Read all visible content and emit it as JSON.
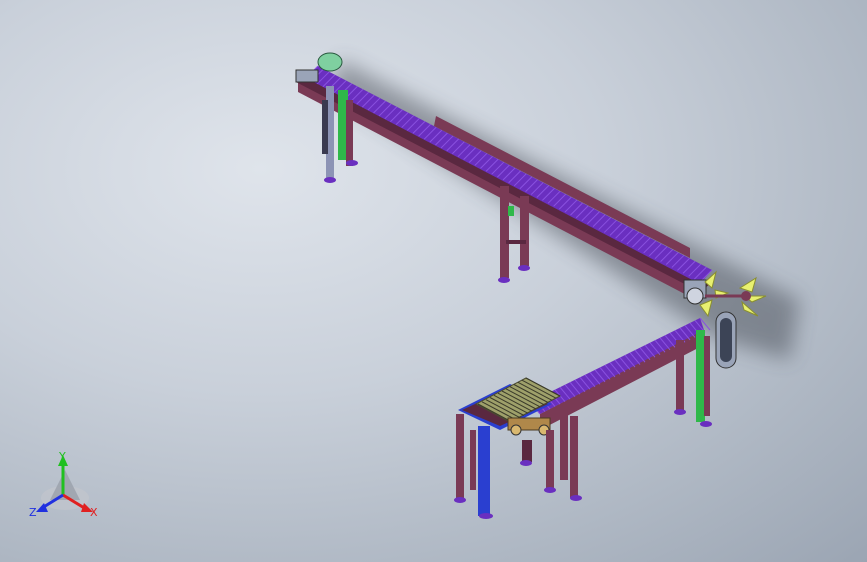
{
  "viewport": {
    "background_top": "#dfe4eb",
    "background_bottom": "#9ba5b3"
  },
  "model": {
    "description_icon": "conveyor-assembly-icon",
    "colors": {
      "belt": "#6a2fc0",
      "belt_light": "#8a52e0",
      "frame": "#7a3a55",
      "frame_dark": "#5a2840",
      "leg_green": "#2fb84a",
      "leg_blue": "#2a3fd0",
      "leg_grey": "#8c93b5",
      "fan_yellow": "#e8f070",
      "motor_grey": "#9aa4b8"
    }
  },
  "triad": {
    "y_label": "Y",
    "z_label": "Z",
    "x_label": "X",
    "y_color": "#20c020",
    "z_color": "#2030e0",
    "x_color": "#e02020"
  }
}
